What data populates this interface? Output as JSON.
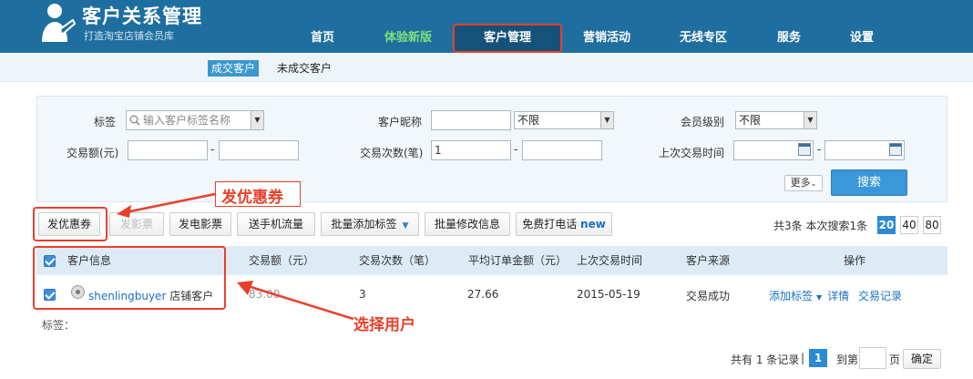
{
  "header": {
    "title": "客户关系管理",
    "subtitle": "打造淘宝店铺会员库",
    "nav": [
      "首页",
      "体验新版",
      "客户管理",
      "营销活动",
      "无线专区",
      "服务",
      "设置"
    ]
  },
  "subnav": {
    "tabs": [
      "成交客户",
      "未成交客户"
    ]
  },
  "filter": {
    "tag_label": "标签",
    "tag_placeholder": "输入客户标签名称",
    "nick_label": "客户昵称",
    "nick_select": "不限",
    "level_label": "会员级别",
    "level_select": "不限",
    "amount_label": "交易额(元)",
    "count_label": "交易次数(笔)",
    "count_value": "1",
    "last_label": "上次交易时间",
    "dash": "-",
    "more_label": "更多",
    "search_label": "搜索"
  },
  "actions": {
    "coupon": "发优惠券",
    "movie": "发影票",
    "emovie": "发电影票",
    "traffic": "送手机流量",
    "batch_tag": "批量添加标签",
    "batch_edit": "批量修改信息",
    "call": "免费打电话",
    "call_new": "new"
  },
  "stats": {
    "text": "共3条 本次搜索1条",
    "page_sizes": [
      "20",
      "40",
      "80"
    ]
  },
  "table": {
    "headers": [
      "客户信息",
      "交易额（元）",
      "交易次数（笔）",
      "平均订单金额（元）",
      "上次交易时间",
      "客户来源",
      "操作"
    ],
    "row": {
      "name": "shenlingbuyer",
      "type": "店铺客户",
      "amount": "83.00",
      "count": "3",
      "avg": "27.66",
      "last": "2015-05-19",
      "source": "交易成功",
      "op_tag": "添加标签",
      "op_detail": "详情",
      "op_records": "交易记录"
    },
    "tags_label": "标签："
  },
  "annotations": {
    "coupon": "发优惠券",
    "select_user": "选择用户"
  },
  "pager": {
    "total": "共有 1 条记录",
    "sep": "|",
    "current": "1",
    "goto_prefix": "到第",
    "goto_suffix": "页",
    "ok": "确定"
  },
  "colors": {
    "header_bg": "#1e6f9f",
    "accent": "#3a97d9",
    "annotation": "#e8402b"
  }
}
